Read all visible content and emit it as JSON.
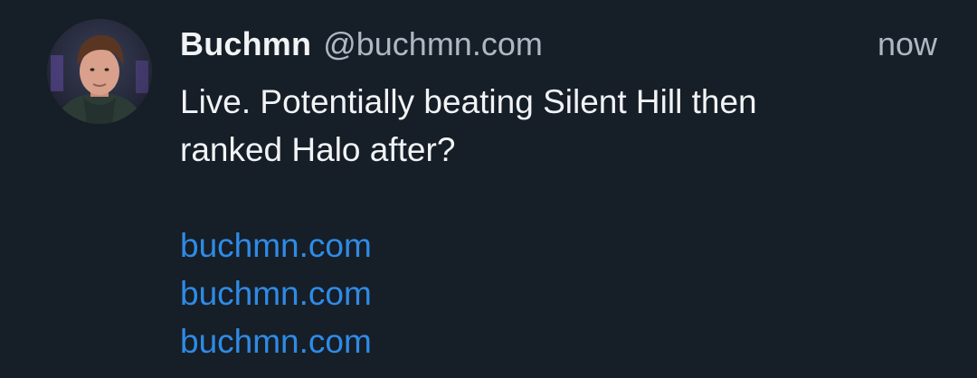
{
  "post": {
    "author": {
      "display_name": "Buchmn",
      "handle": "@buchmn.com",
      "avatar_icon": "user-avatar-photo"
    },
    "timestamp": "now",
    "text_lines": [
      "Live. Potentially beating Silent Hill then",
      "ranked Halo after?"
    ],
    "links": [
      "buchmn.com",
      "buchmn.com",
      "buchmn.com"
    ]
  },
  "colors": {
    "background": "#161e27",
    "primary_text": "#f1f3f5",
    "secondary_text": "#aeb8c4",
    "link": "#2f8be6"
  }
}
